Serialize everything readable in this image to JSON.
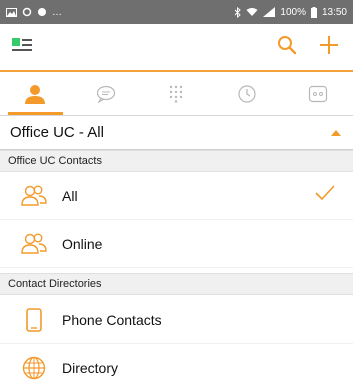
{
  "status_bar": {
    "battery": "100%",
    "time": "13:50"
  },
  "tabs": [
    {
      "name": "contacts",
      "active": true
    },
    {
      "name": "messages",
      "active": false
    },
    {
      "name": "dialpad",
      "active": false
    },
    {
      "name": "history",
      "active": false
    },
    {
      "name": "voicemail",
      "active": false
    }
  ],
  "filter": {
    "title": "Office UC - All"
  },
  "sections": {
    "office_uc": {
      "header": "Office UC Contacts",
      "items": [
        {
          "label": "All",
          "selected": true
        },
        {
          "label": "Online",
          "selected": false
        }
      ]
    },
    "directories": {
      "header": "Contact Directories",
      "items": [
        {
          "label": "Phone Contacts"
        },
        {
          "label": "Directory"
        }
      ]
    }
  },
  "colors": {
    "accent": "#f39a2b",
    "status_bar": "#6f6f6f",
    "brand_green": "#33cc66"
  }
}
